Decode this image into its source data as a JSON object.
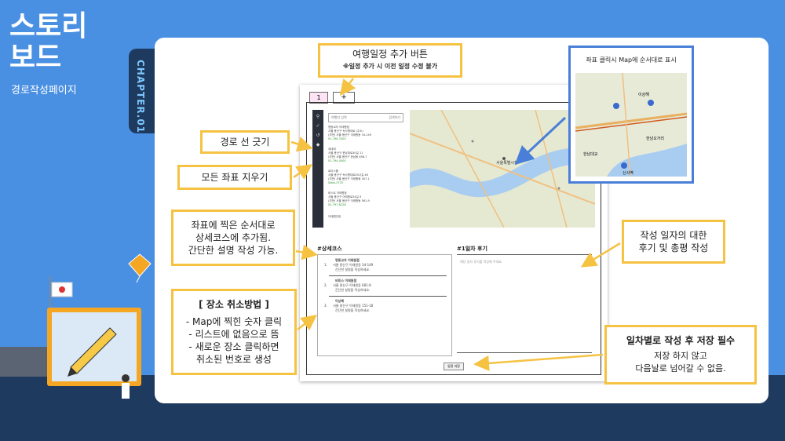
{
  "slide": {
    "title_line1": "스토리",
    "title_line2": "보드",
    "subtitle": "경로작성페이지",
    "chapter": "CHAPTER.01"
  },
  "callouts": {
    "add_itinerary_title": "여행일정 추가 버튼",
    "add_itinerary_note": "※일정 추가 시 이전 일정 수정 불가",
    "map_click_caption": "좌표 클릭시 Map에 순서대로 표시",
    "draw_route": "경로 선 긋기",
    "clear_coords": "모든 좌표 지우기",
    "add_to_detail_line1": "좌표에 찍은 순서대로",
    "add_to_detail_line2": "상세코스에 추가됨.",
    "add_to_detail_line3": "간단한 설명 작성 가능.",
    "cancel_title": "[ 장소 취소방법 ]",
    "cancel_line1": "- Map에 찍힌 숫자 클릭",
    "cancel_line2": "- 리스트에 없음으로 뜸",
    "cancel_line3": "- 새로운 장소 클릭하면",
    "cancel_line4": "취소된 번호로 생성",
    "review_line1": "작성 일자의 대한",
    "review_line2": "후기 및 총평 작성",
    "save_title": "일차별로 작성 후 저장 필수",
    "save_line1": "저장 하지 않고",
    "save_line2": "다음날로 넘어갈 수 없음."
  },
  "app": {
    "day_tab": "1",
    "add_tab": "+",
    "search_placeholder": "여행지 입력",
    "search_button": "검색하기",
    "places": [
      {
        "name": "명동교자 이태원점",
        "addr": "서울 용산구 녹사평대로 (주소)",
        "sub": "(지번) 서울 용산구 이태원동 34-149",
        "tel": "02-790-7000"
      },
      {
        "name": "세네비",
        "addr": "서울 용산구 한남대로40길 11",
        "sub": "(지번) 서울 용산구 한남동 658-7",
        "tel": "02-794-4004"
      },
      {
        "name": "로티스홀",
        "addr": "서울 용산구 녹사평대로40나길 46",
        "sub": "(지번) 서울 용산구 이태원동 457-1",
        "tel": "Seba-3733"
      },
      {
        "name": "비스트 이태원점",
        "addr": "서울 용산구 이태원로54길 9",
        "sub": "(지번) 서울 용산구 이태원동 561-9",
        "tel": "02-797-8228"
      },
      {
        "name": "이태원관광",
        "addr": "",
        "sub": "",
        "tel": ""
      }
    ],
    "map_label": "서울특별시청",
    "detail_label": "#상세코스",
    "review_label": "#1일차 후기",
    "review_placeholder": "해당 일자 후기를 작성해 주세요.",
    "detail_items": [
      {
        "num": "1.",
        "name": "명동교자 이태원점",
        "addr": "서울 용산구 이태원동 34-149",
        "note": "간단한 설명을 작성하세요."
      },
      {
        "num": "2.",
        "name": "비트스 이태원점",
        "addr": "서울 용산구 이태원동 681-8",
        "note": "간단한 설명을 작성하세요."
      },
      {
        "num": "3.",
        "name": "이상해",
        "addr": "서울 용산구 이태원동 151-18",
        "note": "간단한 설명을 작성하세요."
      }
    ],
    "save_button": "일정 저장"
  },
  "mini_map": {
    "labels": [
      "한남오거리",
      "이상해",
      "한남대교",
      "신사역"
    ]
  },
  "colors": {
    "background": "#4a90e2",
    "dark_navy": "#1e3a5f",
    "callout_border": "#f5c242",
    "map_callout_border": "#4a7fd9"
  }
}
